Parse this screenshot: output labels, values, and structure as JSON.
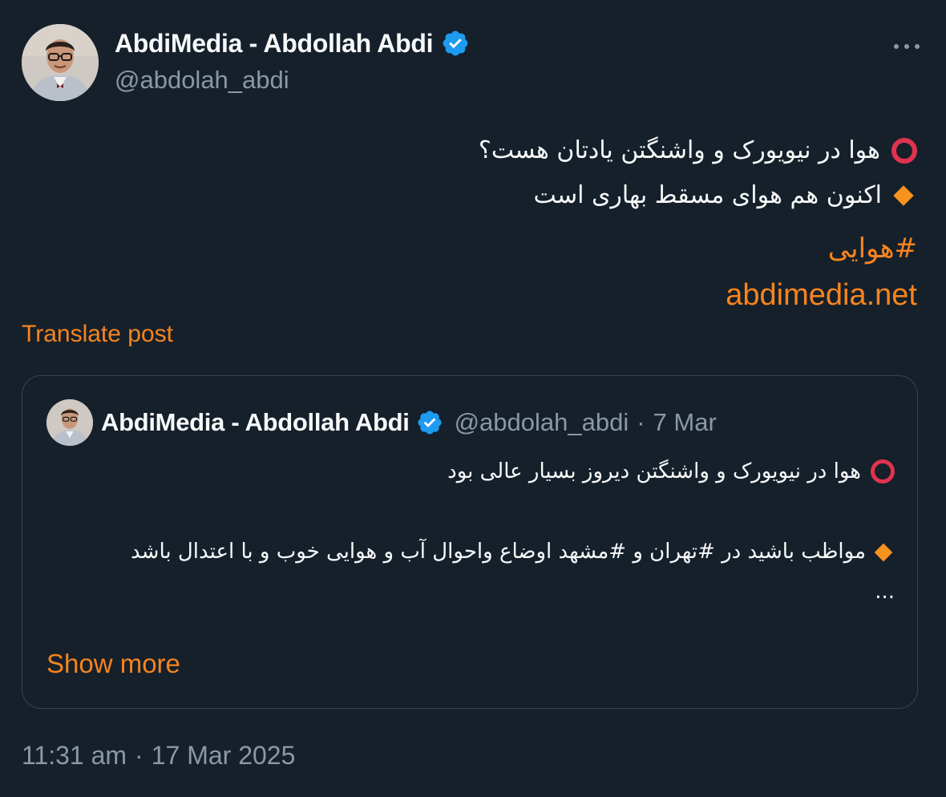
{
  "post": {
    "author": {
      "display_name": "AbdiMedia - Abdollah Abdi",
      "handle": "@abdolah_abdi",
      "verified_icon": "verified-badge-icon",
      "avatar_icon": "profile-photo-avatar"
    },
    "more_icon": "more-dots-icon",
    "text": {
      "line1_icon": "red-circle-emoji",
      "line1": "هوا در نیویورک و واشنگتن یادتان هست؟",
      "line2_icon": "orange-diamond-emoji",
      "line2": "اکنون هم هوای مسقط بهاری است",
      "hashtag": "#هوایی",
      "link": "abdimedia.net"
    },
    "translate_label": "Translate post",
    "time": "11:31 am",
    "date": "17 Mar 2025",
    "separator": "·"
  },
  "quoted": {
    "display_name": "AbdiMedia - Abdollah Abdi",
    "handle": "@abdolah_abdi",
    "separator": "·",
    "date": "7 Mar",
    "line1": "هوا در نیویورک و واشنگتن دیروز بسیار عالی بود",
    "line2_part1": "مواظب باشید در ",
    "hashtag_tehran": "#تهران",
    "line2_part2": " و ",
    "hashtag_mashhad": "#مشهد",
    "line2_part3": " اوضاع واحوال آب و هوایی خوب و با اعتدال باشد",
    "ellipsis": "...",
    "show_more": "Show more"
  },
  "colors": {
    "background": "#15202b",
    "text": "#f7f9f9",
    "muted": "#8b98a5",
    "accent": "#f7841e",
    "verified": "#1d9bf0",
    "border": "#38444d",
    "red_circle": "#e0334f",
    "orange_diamond": "#f6921e"
  }
}
